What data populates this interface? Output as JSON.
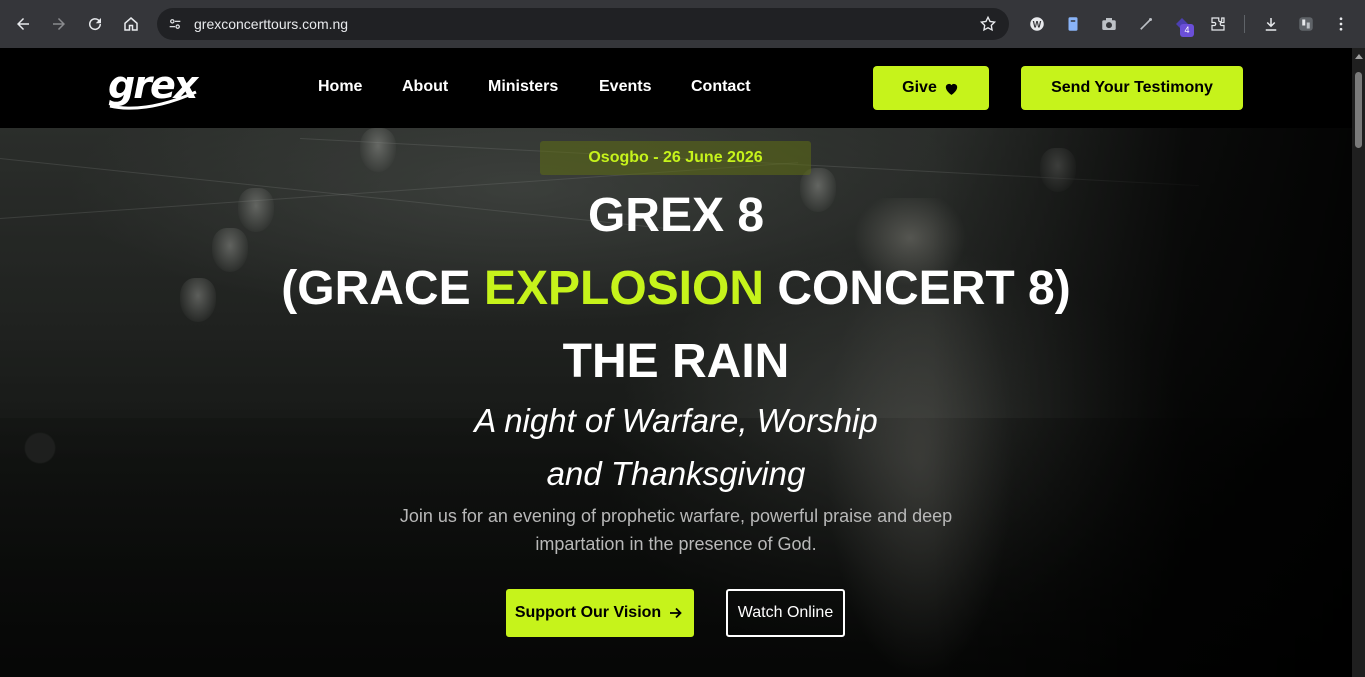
{
  "browser": {
    "url": "grexconcerttours.com.ng",
    "extension_badge": "4",
    "icons": [
      "back-icon",
      "forward-icon",
      "reload-icon",
      "home-icon",
      "site-info-icon",
      "bookmark-star-icon",
      "extensions-icon",
      "downloads-icon",
      "menu-icon"
    ]
  },
  "site": {
    "logo_text": "grex",
    "nav": {
      "home": "Home",
      "about": "About",
      "ministers": "Ministers",
      "events": "Events",
      "contact": "Contact"
    },
    "give_label": "Give",
    "testimony_label": "Send Your Testimony"
  },
  "hero": {
    "date": "Osogbo - 26 June 2026",
    "title_line1": "GREX 8",
    "title_line2_pre": "(GRACE ",
    "title_line2_accent": "EXPLOSION",
    "title_line2_post": " CONCERT 8)",
    "title_line3": "THE RAIN",
    "tagline_line1": "A night of Warfare, Worship",
    "tagline_line2": "and Thanksgiving",
    "description_line1": "Join us for an evening of prophetic warfare, powerful praise and deep",
    "description_line2": "impartation in the presence of God.",
    "support_label": "Support Our Vision",
    "watch_label": "Watch Online"
  },
  "colors": {
    "accent": "#c6f31b",
    "header_bg": "#000000",
    "chrome_bg": "#35363a"
  }
}
